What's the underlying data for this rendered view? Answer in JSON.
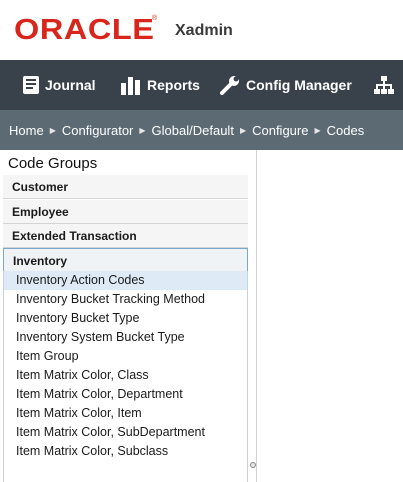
{
  "brand": {
    "logo_text": "ORACLE",
    "registered_mark": "®",
    "app_name": "Xadmin"
  },
  "nav": {
    "items": [
      {
        "label": "Journal",
        "icon": "book-icon"
      },
      {
        "label": "Reports",
        "icon": "bar-chart-icon"
      },
      {
        "label": "Config Manager",
        "icon": "wrench-icon"
      },
      {
        "label": "",
        "icon": "sitemap-icon"
      }
    ]
  },
  "breadcrumb": {
    "items": [
      "Home",
      "Configurator",
      "Global/Default",
      "Configure",
      "Codes"
    ],
    "separator_icon": "triangle-right-icon"
  },
  "code_groups": {
    "title": "Code Groups",
    "headers": [
      "Customer",
      "Employee",
      "Extended Transaction",
      "Inventory"
    ],
    "expanded": "Inventory",
    "items": [
      "Inventory Action Codes",
      "Inventory Bucket Tracking Method",
      "Inventory Bucket Type",
      "Inventory System Bucket Type",
      "Item Group",
      "Item Matrix Color, Class",
      "Item Matrix Color, Department",
      "Item Matrix Color, Item",
      "Item Matrix Color, SubDepartment",
      "Item Matrix Color, Subclass"
    ],
    "selected": "Inventory Action Codes"
  },
  "colors": {
    "brand_red": "#d8261c",
    "nav_bg": "#39424a",
    "breadcrumb_bg": "#5c6a74",
    "selected_bg": "#deebf7"
  }
}
